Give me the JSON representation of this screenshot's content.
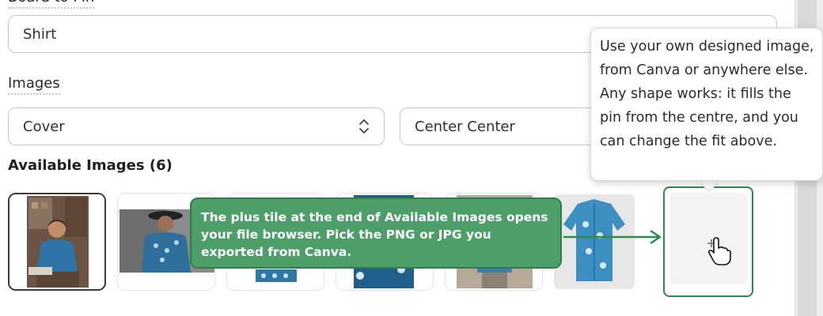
{
  "form": {
    "board_label": "Board to Pin",
    "board_value": "Shirt",
    "images_label": "Images",
    "cover_value": "Cover",
    "position_value": "Center Center"
  },
  "gallery": {
    "title": "Available Images (6)",
    "images": [
      {
        "name": "man-in-blue-shirt-portrait",
        "selected": true
      },
      {
        "name": "man-in-hat-blue-shirt",
        "selected": false
      },
      {
        "name": "blue-patterned-shirt",
        "selected": false
      },
      {
        "name": "blue-printed-shirt-closeup",
        "selected": false
      },
      {
        "name": "man-wearing-shirt-standing",
        "selected": false
      },
      {
        "name": "blue-shirt-flat-lay",
        "selected": false
      }
    ],
    "add_tile_icon": "plus-icon",
    "cursor_icon": "hand-pointer-icon"
  },
  "tooltip": {
    "text": "Use your own designed image, from Canva or anywhere else. Any shape works: it fills the pin from the centre, and you can change the fit above."
  },
  "callout": {
    "text": "The plus tile at the end of Available Images opens your file browser. Pick the PNG or JPG you exported from Canva."
  },
  "colors": {
    "callout_bg": "#4e9e6a",
    "callout_border": "#2e8a4d",
    "field_border": "#c9c9c9"
  }
}
